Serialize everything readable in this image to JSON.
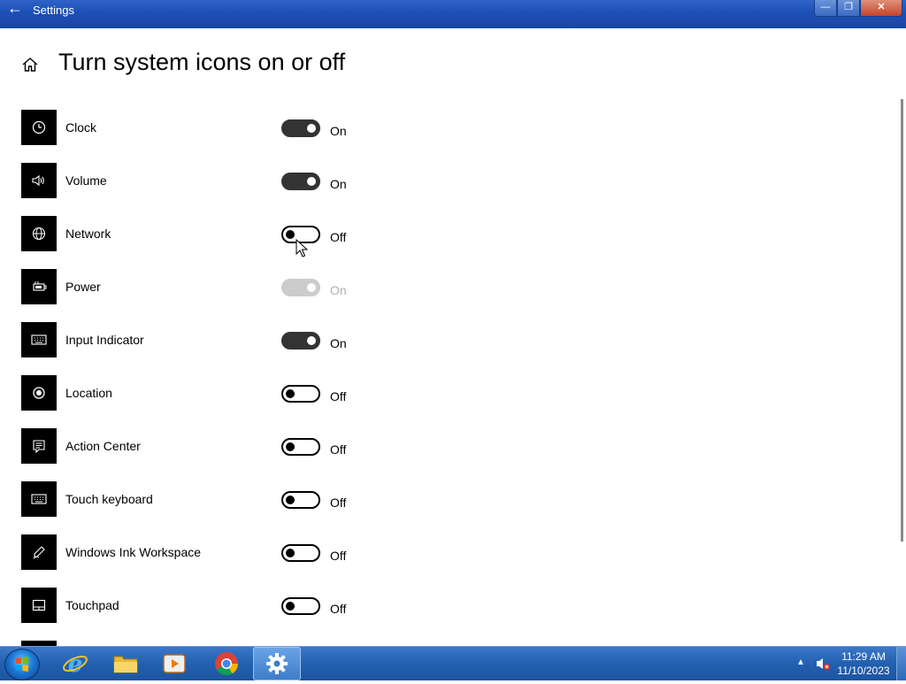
{
  "window": {
    "title": "Settings",
    "back_glyph": "←",
    "minimize": "—",
    "maximize": "❐",
    "close": "✕"
  },
  "header": {
    "title": "Turn system icons on or off"
  },
  "items": [
    {
      "label": "Clock",
      "state": "On",
      "on": true,
      "enabled": true,
      "icon": "clock-icon"
    },
    {
      "label": "Volume",
      "state": "On",
      "on": true,
      "enabled": true,
      "icon": "volume-icon"
    },
    {
      "label": "Network",
      "state": "Off",
      "on": false,
      "enabled": true,
      "icon": "globe-icon"
    },
    {
      "label": "Power",
      "state": "On",
      "on": true,
      "enabled": false,
      "icon": "battery-icon"
    },
    {
      "label": "Input Indicator",
      "state": "On",
      "on": true,
      "enabled": true,
      "icon": "keyboard-icon"
    },
    {
      "label": "Location",
      "state": "Off",
      "on": false,
      "enabled": true,
      "icon": "location-icon"
    },
    {
      "label": "Action Center",
      "state": "Off",
      "on": false,
      "enabled": true,
      "icon": "action-center-icon"
    },
    {
      "label": "Touch keyboard",
      "state": "Off",
      "on": false,
      "enabled": true,
      "icon": "touch-keyboard-icon"
    },
    {
      "label": "Windows Ink Workspace",
      "state": "Off",
      "on": false,
      "enabled": true,
      "icon": "pen-icon"
    },
    {
      "label": "Touchpad",
      "state": "Off",
      "on": false,
      "enabled": true,
      "icon": "touchpad-icon"
    }
  ],
  "taskbar": {
    "apps": [
      "start-orb",
      "internet-explorer-icon",
      "file-explorer-icon",
      "media-player-icon",
      "chrome-icon",
      "settings-gear-icon"
    ],
    "tray_arrow": "▲",
    "time": "11:29 AM",
    "date": "11/10/2023"
  },
  "colors": {
    "titlebar": "#1d4fb6",
    "taskbar": "#2360b0",
    "toggle_on": "#333333",
    "toggle_disabled": "#cccccc"
  }
}
